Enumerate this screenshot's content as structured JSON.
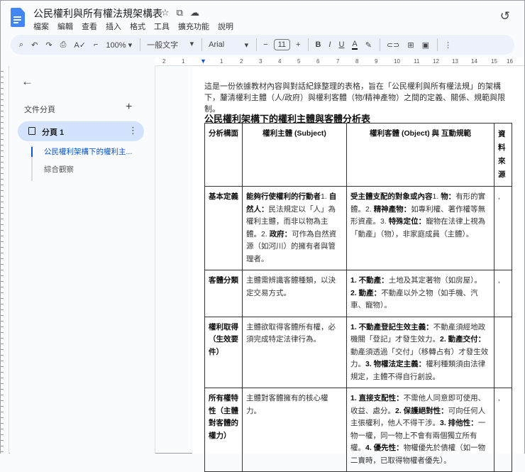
{
  "header": {
    "title": "公民權利與所有權法規架構表",
    "menu": [
      "檔案",
      "編輯",
      "查看",
      "插入",
      "格式",
      "工具",
      "擴充功能",
      "說明"
    ]
  },
  "toolbar": {
    "zoom": "100%",
    "style": "一般文字",
    "font": "Arial",
    "font_size": "11"
  },
  "ruler": {
    "ticks": [
      "2",
      "1",
      "1",
      "2",
      "3",
      "4",
      "5",
      "6",
      "7",
      "8",
      "9",
      "10",
      "11",
      "12",
      "13",
      "14",
      "15",
      "16"
    ]
  },
  "sidebar": {
    "heading": "文件分頁",
    "tab_label": "分頁 1",
    "outline": [
      "公民權利架構下的權利主...",
      "綜合觀察"
    ]
  },
  "doc": {
    "intro": "這是一份依據教材內容與對話紀錄整理的表格，旨在「公民權利與所有權法規」的架構下，釐清權利主體（人/政府）與權利客體（物/精神產物）之間的定義、關係、規範與限制。",
    "heading": "公民權利架構下的權利主體與客體分析表",
    "columns": [
      "分析構面",
      "權利主體 (Subject)",
      "權利客體 (Object) 與 互動規範",
      "資料來源"
    ],
    "rows": [
      {
        "dim": "基本定義",
        "subject": [
          {
            "t": "能夠行使權利的行動者",
            "b": true
          },
          {
            "t": "1. ",
            "b": false
          },
          {
            "t": "自然人：",
            "b": true
          },
          {
            "t": "民法規定以「人」為權利主體，而非以物為主體。2. ",
            "b": false
          },
          {
            "t": "政府：",
            "b": true
          },
          {
            "t": "可作為自然資源（如河川）的擁有者與管理者。",
            "b": false
          }
        ],
        "object": [
          {
            "t": "受主體支配的對象或內容",
            "b": true
          },
          {
            "t": "1. ",
            "b": false
          },
          {
            "t": "物：",
            "b": true
          },
          {
            "t": "有形的實體。2. ",
            "b": false
          },
          {
            "t": "精神產物：",
            "b": true
          },
          {
            "t": "如專利權、著作權等無形資產。3. ",
            "b": false
          },
          {
            "t": "特殊定位：",
            "b": true
          },
          {
            "t": "寵物在法律上視為「動產」（物），非家庭成員（主體）。",
            "b": false
          }
        ],
        "source": ","
      },
      {
        "dim": "客體分類",
        "subject": [
          {
            "t": "主體需辨識客體種類，以決定交易方式。",
            "b": false
          }
        ],
        "object": [
          {
            "t": "1. 不動產：",
            "b": true
          },
          {
            "t": "土地及其定著物（如房屋）。",
            "b": false
          },
          {
            "t": "2. 動產：",
            "b": true,
            "br": true
          },
          {
            "t": "不動產以外之物（如手機、汽車、寵物）。",
            "b": false
          }
        ],
        "source": ","
      },
      {
        "dim": "權利取得（生效要件）",
        "subject": [
          {
            "t": "主體欲取得客體所有權，必須完成特定法律行為。",
            "b": false
          }
        ],
        "object": [
          {
            "t": "1. 不動產登記生效主義：",
            "b": true
          },
          {
            "t": "不動產須經地政機關「登記」才發生效力。",
            "b": false
          },
          {
            "t": "2. 動產交付：",
            "b": true
          },
          {
            "t": "動產須透過「交付」（移轉占有）才發生效力。",
            "b": false
          },
          {
            "t": "3. 物權法定主義：",
            "b": true
          },
          {
            "t": "權利種類須由法律規定，主體不得自行創設。",
            "b": false
          }
        ],
        "source": ""
      },
      {
        "dim": "所有權特性（主體對客體的權力）",
        "subject": [
          {
            "t": "主體對客體擁有的核心權力。",
            "b": false
          }
        ],
        "object": [
          {
            "t": "1. 直接支配性：",
            "b": true
          },
          {
            "t": "不需他人同意即可使用、收益、處分。",
            "b": false
          },
          {
            "t": "2. 保護絕對性：",
            "b": true
          },
          {
            "t": "可向任何人主張權利，他人不得干涉。",
            "b": false
          },
          {
            "t": "3. 排他性：",
            "b": true
          },
          {
            "t": "一物一權，同一物上不會有兩個獨立所有權。",
            "b": false
          },
          {
            "t": "4. 優先性：",
            "b": true
          },
          {
            "t": "物權優先於債權（如一物二賣時，已取得物權者優先）。",
            "b": false
          }
        ],
        "source": ","
      }
    ]
  }
}
